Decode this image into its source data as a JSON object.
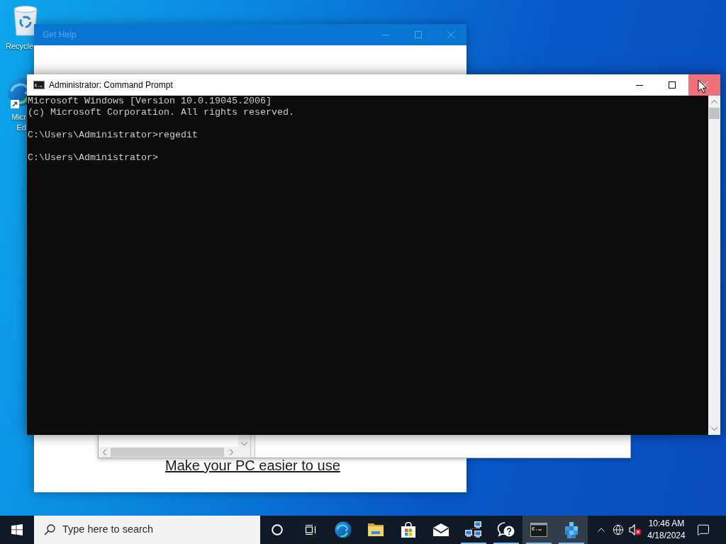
{
  "desktop": {
    "icons": [
      {
        "kind": "recycle-bin",
        "label": [
          "Recycle"
        ]
      },
      {
        "kind": "edge",
        "label": [
          "Micr",
          "Ed"
        ]
      }
    ]
  },
  "get_help_window": {
    "title": "Get Help",
    "active": false,
    "link": "Make your PC easier to use"
  },
  "command_prompt": {
    "title": "Administrator: Command Prompt",
    "close_hovered": true,
    "output": [
      [
        "Microsoft Windows [Version 10.0.19045.2006]",
        "(c) Microsoft Corporation. All rights reserved."
      ],
      [
        "C:\\Users\\Administrator>regedit"
      ],
      [
        "C:\\Users\\Administrator>"
      ]
    ]
  },
  "taskbar": {
    "search": {
      "placeholder": "Type here to search"
    },
    "apps": [
      {
        "kind": "edge",
        "running": false,
        "selected": false
      },
      {
        "kind": "file-explorer",
        "running": false,
        "selected": false
      },
      {
        "kind": "store",
        "running": false,
        "selected": false
      },
      {
        "kind": "mail",
        "running": false,
        "selected": false
      },
      {
        "kind": "network",
        "running": true,
        "selected": false
      },
      {
        "kind": "get-help",
        "running": true,
        "selected": false
      },
      {
        "kind": "command-prompt",
        "running": true,
        "selected": true
      },
      {
        "kind": "registry-editor",
        "running": true,
        "selected": true
      }
    ],
    "tray": {
      "volume_muted": true
    },
    "clock": {
      "time": "10:46 AM",
      "date": "4/18/2024"
    }
  }
}
